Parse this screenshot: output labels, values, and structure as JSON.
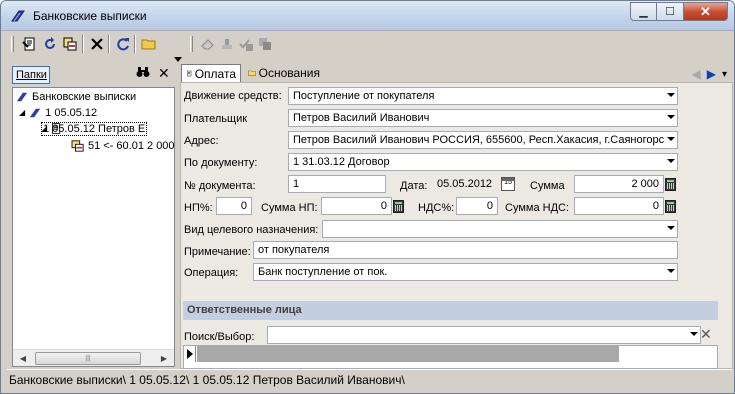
{
  "window": {
    "title": "Банковские выписки",
    "controls": {
      "minimize": "▁",
      "maximize": "☐",
      "close": "✕"
    }
  },
  "toolbar": {
    "buttons": [
      {
        "name": "edit-doc-icon",
        "glyph": "🗎"
      },
      {
        "name": "undo-icon",
        "glyph": "↺"
      },
      {
        "name": "redo-icon",
        "glyph": "↻"
      },
      {
        "name": "copy-icon",
        "glyph": "⧉"
      },
      {
        "name": "delete-icon",
        "glyph": "✕"
      },
      {
        "name": "refresh-icon",
        "glyph": "⟳"
      },
      {
        "name": "folder-icon",
        "glyph": "📂"
      },
      {
        "name": "eraser-icon",
        "glyph": "⌫"
      },
      {
        "name": "stamp-icon",
        "glyph": "⛉"
      },
      {
        "name": "approve-icon",
        "glyph": "✔"
      },
      {
        "name": "copy-disabled-icon",
        "glyph": "▣"
      }
    ]
  },
  "left_panel": {
    "tab_label": "Папки",
    "search_glyph": "🔭",
    "close_glyph": "✕",
    "tree": [
      {
        "label": "Банковские выписки",
        "level": 0
      },
      {
        "label": "1 05.05.12",
        "level": 1
      },
      {
        "label": "1 05.05.12 Петров Е",
        "level": 2,
        "selected": true
      },
      {
        "label": "51 <- 60.01 2 000",
        "level": 3
      }
    ],
    "scroll_left": "◀",
    "scroll_right": "▶",
    "scroll_thumb": "|||"
  },
  "tabs": [
    {
      "label": "Оплата",
      "active": true
    },
    {
      "label": "Основания",
      "active": false
    }
  ],
  "nav": {
    "prev": "◀",
    "next": "▶",
    "menu": "▾"
  },
  "form": {
    "movement": {
      "label": "Движение средств:",
      "value": "Поступление от покупателя"
    },
    "payer": {
      "label": "Плательщик",
      "value": "Петров Василий Иванович"
    },
    "address": {
      "label": "Адрес:",
      "value": "Петров Василий Иванович РОССИЯ, 655600, Респ.Хакасия, г.Саяногорс"
    },
    "by_document": {
      "label": "По документу:",
      "value": "1 31.03.12 Договор"
    },
    "doc_number": {
      "label": "№ документа:",
      "value": "1"
    },
    "date": {
      "label": "Дата:",
      "value": "05.05.2012",
      "calendar_day": "15"
    },
    "sum": {
      "label": "Сумма",
      "value": "2 000"
    },
    "np_percent": {
      "label": "НП%:",
      "value": "0"
    },
    "np_sum": {
      "label": "Сумма НП:",
      "value": "0"
    },
    "nds_percent": {
      "label": "НДС%:",
      "value": "0"
    },
    "nds_sum": {
      "label": "Сумма НДС:",
      "value": "0"
    },
    "purpose": {
      "label": "Вид целевого назначения:",
      "value": ""
    },
    "note": {
      "label": "Примечание:",
      "value": "от покупателя"
    },
    "operation": {
      "label": "Операция:",
      "value": "Банк поступление от пок."
    },
    "section_title": "Ответственные лица",
    "search": {
      "label": "Поиск/Выбор:",
      "value": "",
      "clear_glyph": "✕"
    }
  },
  "status_bar": "Банковские выписки\\ 1 05.05.12\\ 1 05.05.12 Петров Василий Иванович\\"
}
